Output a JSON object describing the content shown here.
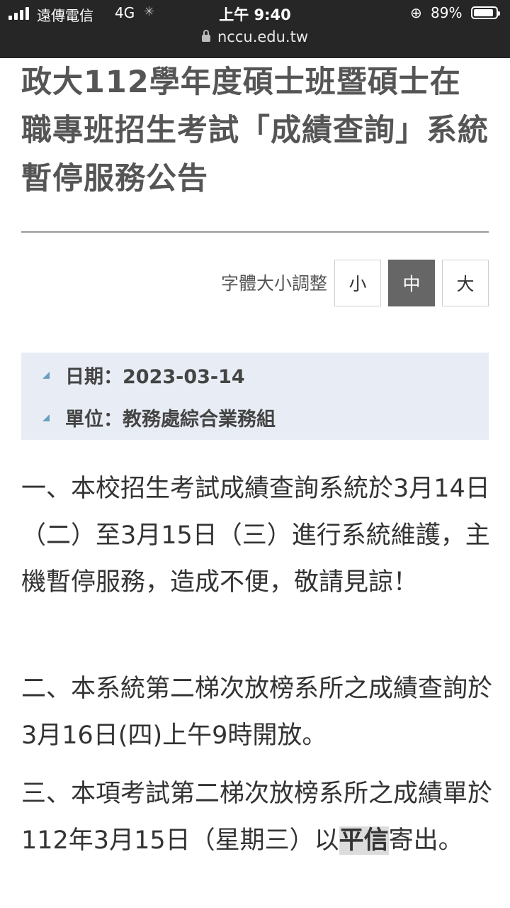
{
  "status_bar": {
    "carrier": "遠傳電信",
    "network": "4G",
    "time": "上午 9:40",
    "url": "nccu.edu.tw",
    "battery": "89%",
    "battery_level": 0.89
  },
  "article": {
    "title": "政大112學年度碩士班暨碩士在職專班招生考試「成績查詢」系統暫停服務公告"
  },
  "font_size": {
    "label": "字體大小調整",
    "small": "小",
    "medium": "中",
    "large": "大",
    "selected": "medium"
  },
  "meta": {
    "date": "日期：2023-03-14",
    "unit": "單位：教務處綜合業務組"
  },
  "content": {
    "p1": "一、本校招生考試成績查詢系統於3月14日（二）至3月15日（三）進行系統維護，主機暫停服務，造成不便，敬請見諒！",
    "p2": "二、本系統第二梯次放榜系所之成績查詢於3月16日(四)上午9時開放。",
    "p3_before": "三、本項考試第二梯次放榜系所之成績單於112年3月15日（星期三）以",
    "p3_highlight": "平信",
    "p3_after": "寄出。"
  },
  "colors": {
    "status_bar_bg": "#262626",
    "info_bg": "#e8edf5",
    "selected_button_bg": "#666666",
    "bullet_triangle": "#6a9fc2"
  }
}
